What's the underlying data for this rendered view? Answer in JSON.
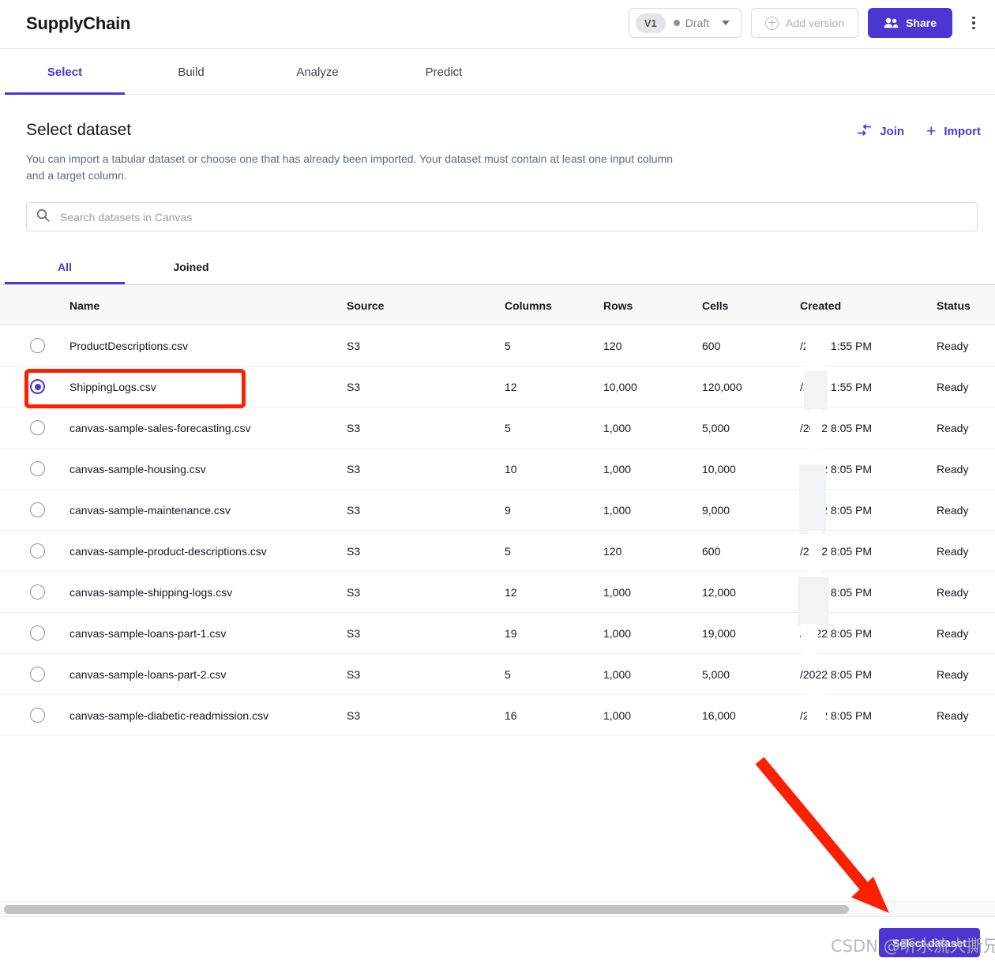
{
  "header": {
    "app_title": "SupplyChain",
    "version_chip": "V1",
    "status_label": "Draft",
    "add_version_label": "Add version",
    "share_label": "Share",
    "more_menu_name": "more-options",
    "accent_color": "#4b36d4"
  },
  "main_tabs": [
    {
      "label": "Select",
      "active": true
    },
    {
      "label": "Build",
      "active": false
    },
    {
      "label": "Analyze",
      "active": false
    },
    {
      "label": "Predict",
      "active": false
    }
  ],
  "section": {
    "title": "Select dataset",
    "description": "You can import a tabular dataset or choose one that has already been imported. Your dataset must contain at least one input column and a target column.",
    "join_label": "Join",
    "import_label": "Import"
  },
  "search": {
    "placeholder": "Search datasets in Canvas",
    "value": ""
  },
  "sub_tabs": [
    {
      "label": "All",
      "active": true
    },
    {
      "label": "Joined",
      "active": false
    }
  ],
  "table": {
    "columns": [
      "Name",
      "Source",
      "Columns",
      "Rows",
      "Cells",
      "Created",
      "Status"
    ],
    "rows": [
      {
        "name": "ProductDescriptions.csv",
        "source": "S3",
        "columns": "5",
        "rows": "120",
        "cells": "600",
        "created": "/2022 1:55 PM",
        "status": "Ready",
        "selected": false
      },
      {
        "name": "ShippingLogs.csv",
        "source": "S3",
        "columns": "12",
        "rows": "10,000",
        "cells": "120,000",
        "created": "/2022 1:55 PM",
        "status": "Ready",
        "selected": true
      },
      {
        "name": "canvas-sample-sales-forecasting.csv",
        "source": "S3",
        "columns": "5",
        "rows": "1,000",
        "cells": "5,000",
        "created": "/2022 8:05 PM",
        "status": "Ready",
        "selected": false
      },
      {
        "name": "canvas-sample-housing.csv",
        "source": "S3",
        "columns": "10",
        "rows": "1,000",
        "cells": "10,000",
        "created": "/2022 8:05 PM",
        "status": "Ready",
        "selected": false
      },
      {
        "name": "canvas-sample-maintenance.csv",
        "source": "S3",
        "columns": "9",
        "rows": "1,000",
        "cells": "9,000",
        "created": "/2022 8:05 PM",
        "status": "Ready",
        "selected": false
      },
      {
        "name": "canvas-sample-product-descriptions.csv",
        "source": "S3",
        "columns": "5",
        "rows": "120",
        "cells": "600",
        "created": "/2022 8:05 PM",
        "status": "Ready",
        "selected": false
      },
      {
        "name": "canvas-sample-shipping-logs.csv",
        "source": "S3",
        "columns": "12",
        "rows": "1,000",
        "cells": "12,000",
        "created": "/2022 8:05 PM",
        "status": "Ready",
        "selected": false
      },
      {
        "name": "canvas-sample-loans-part-1.csv",
        "source": "S3",
        "columns": "19",
        "rows": "1,000",
        "cells": "19,000",
        "created": "/2022 8:05 PM",
        "status": "Ready",
        "selected": false
      },
      {
        "name": "canvas-sample-loans-part-2.csv",
        "source": "S3",
        "columns": "5",
        "rows": "1,000",
        "cells": "5,000",
        "created": "/2022 8:05 PM",
        "status": "Ready",
        "selected": false
      },
      {
        "name": "canvas-sample-diabetic-readmission.csv",
        "source": "S3",
        "columns": "16",
        "rows": "1,000",
        "cells": "16,000",
        "created": "/2022 8:05 PM",
        "status": "Ready",
        "selected": false
      }
    ]
  },
  "footer": {
    "select_dataset_label": "Select dataset"
  },
  "annotations": {
    "highlight_color": "#fa2000",
    "watermark_prefix": "CSDN ",
    "watermark_handle": "@听水流大撕兄"
  }
}
